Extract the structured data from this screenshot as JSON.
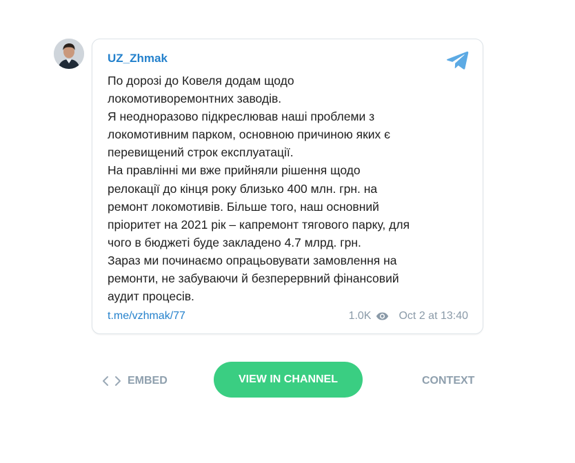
{
  "channel": {
    "name": "UZ_Zhmak",
    "avatar_icon": "person-photo-icon",
    "brand_icon": "telegram-icon",
    "accent_color": "#2481cc"
  },
  "post": {
    "lines": [
      "По дорозі до Ковеля додам щодо",
      "локомотиворемонтних заводів.",
      "Я неодноразово підкреслював наші проблеми з",
      "локомотивним парком, основною причиною яких є",
      "перевищений строк експлуатації.",
      "На правлінні ми вже прийняли рішення щодо",
      "релокації до кінця року близько 400 млн. грн. на",
      "ремонт локомотивів. Більше того, наш основний",
      "пріоритет на 2021 рік – капремонт тягового парку, для",
      "чого в бюджеті буде закладено 4.7 млрд. грн.",
      "Зараз ми починаємо опрацьовувати замовлення на",
      "ремонти, не забуваючи й безперервний фінансовий",
      "аудит процесів."
    ],
    "link": "t.me/vzhmak/77",
    "views": "1.0K",
    "views_icon": "eye-icon",
    "date": "Oct 2 at 13:40"
  },
  "actions": {
    "embed_label": "EMBED",
    "embed_icon": "code-icon",
    "view_label": "VIEW IN CHANNEL",
    "view_color": "#3ace82",
    "context_label": "CONTEXT"
  }
}
